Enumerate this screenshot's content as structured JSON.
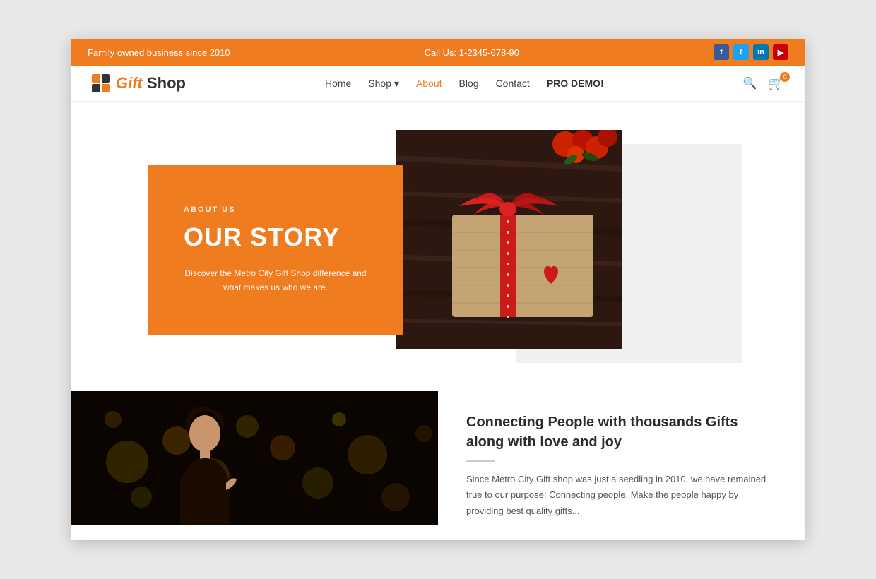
{
  "topbar": {
    "family_text": "Family owned business since 2010",
    "call_text": "Call Us: 1-2345-678-90",
    "social": [
      {
        "name": "Facebook",
        "letter": "f",
        "class": "social-fb"
      },
      {
        "name": "Twitter",
        "letter": "t",
        "class": "social-tw"
      },
      {
        "name": "LinkedIn",
        "letter": "in",
        "class": "social-li"
      },
      {
        "name": "YouTube",
        "letter": "▶",
        "class": "social-yt"
      }
    ]
  },
  "header": {
    "logo_gift": "Gift",
    "logo_shop": " Shop",
    "nav": [
      {
        "label": "Home",
        "active": false
      },
      {
        "label": "Shop",
        "active": false,
        "has_dropdown": true
      },
      {
        "label": "About",
        "active": true
      },
      {
        "label": "Blog",
        "active": false
      },
      {
        "label": "Contact",
        "active": false
      },
      {
        "label": "PRO DEMO!",
        "active": false,
        "special": true
      }
    ],
    "cart_count": "0"
  },
  "hero": {
    "about_us_label": "ABOUT US",
    "title": "OUR STORY",
    "description": "Discover the Metro City Gift Shop difference and what makes us who we are."
  },
  "about": {
    "heading": "Connecting People with thousands Gifts along with love and joy",
    "text": "Since Metro City Gift shop was just a seedling in 2010, we have remained true to our purpose: Connecting people, Make the people happy by providing best quality gifts..."
  }
}
